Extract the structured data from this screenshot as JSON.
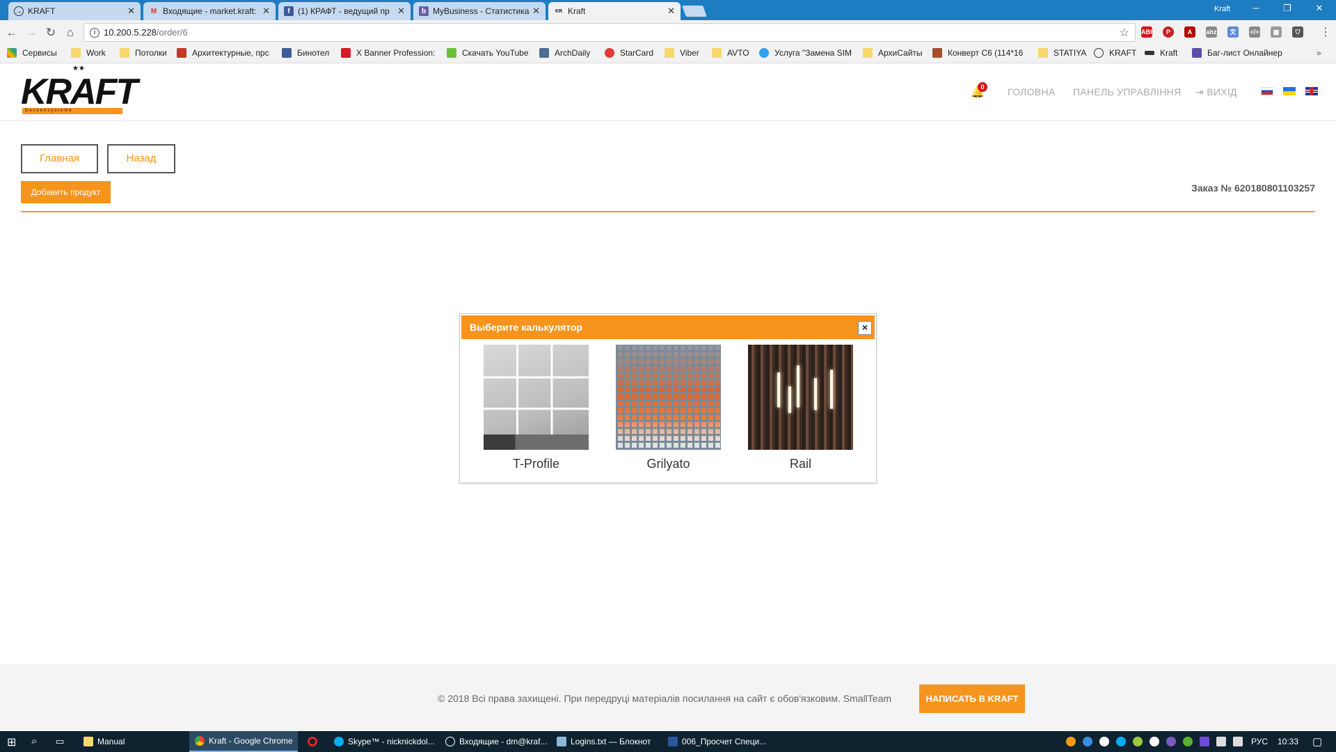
{
  "browser": {
    "tabs": [
      {
        "title": "KRAFT",
        "icon": "kraft-circle-icon"
      },
      {
        "title": "Входящие - market.kraft:",
        "icon": "gmail-icon"
      },
      {
        "title": "(1) КРАФТ - ведущий пр",
        "icon": "facebook-icon"
      },
      {
        "title": "MyBusiness - Статистика",
        "icon": "mybusiness-icon"
      },
      {
        "title": "Kraft",
        "icon": "kraft-logo-icon"
      }
    ],
    "profile_name": "Kraft",
    "url_host": "10.200.5.228",
    "url_path": "/order/6",
    "bookmarks": [
      "Сервисы",
      "Work",
      "Потолки",
      "Архитектурные, прс",
      "Бинотел",
      "X Banner Profession:",
      "Скачать YouTube",
      "ArchDaily",
      "StarCard",
      "Viber",
      "AVTO",
      "Услуга \"Замена SIM",
      "АрхиСайты",
      "Конверт C6 (114*16",
      "STATIYA",
      "KRAFT",
      "Kraft",
      "Баг-лист Онлайнер"
    ]
  },
  "site": {
    "logo_text": "KRAFT",
    "logo_sub": "Deckensysteme",
    "notifications_count": "0",
    "nav": {
      "home": "ГОЛОВНА",
      "dashboard": "ПАНЕЛЬ УПРАВЛІННЯ",
      "logout": "ВИХІД"
    },
    "languages": [
      "ru",
      "ua",
      "en"
    ],
    "accent_color": "#f7941d"
  },
  "page": {
    "main_button": "Главная",
    "back_button": "Назад",
    "add_product_button": "Добавить продукт",
    "order_number": "Заказ № 620180801103257"
  },
  "modal": {
    "title": "Выберите калькулятор",
    "calculators": [
      {
        "label": "T-Profile"
      },
      {
        "label": "Grilyato"
      },
      {
        "label": "Rail"
      }
    ]
  },
  "footer": {
    "copyright": "© 2018 Всі права захищені. При передруці матеріалів посилання на сайт є обов'язковим. SmallTeam",
    "write_button": "НАПИСАТЬ В KRAFT"
  },
  "taskbar": {
    "items": [
      "Manual",
      "Kraft - Google Chrome",
      "",
      "Skype™ - nicknickdol...",
      "Входящие - dm@kraf...",
      "Logins.txt — Блокнот",
      "006_Просчет Специ..."
    ],
    "language": "РУС",
    "time": "10:33"
  }
}
